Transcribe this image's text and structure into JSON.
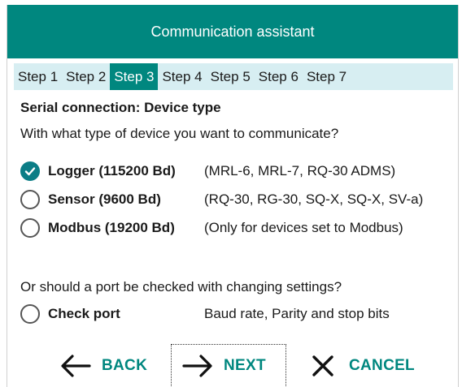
{
  "window": {
    "title": "Communication assistant"
  },
  "steps": [
    "Step 1",
    "Step 2",
    "Step 3",
    "Step 4",
    "Step 5",
    "Step 6",
    "Step 7"
  ],
  "active_step": "Step 3",
  "content": {
    "heading": "Serial connection: Device type",
    "question": "With what type of device you want to communicate?",
    "options": [
      {
        "label": "Logger (115200 Bd)",
        "desc": "(MRL-6, MRL-7, RQ-30 ADMS)",
        "checked": true
      },
      {
        "label": "Sensor (9600 Bd)",
        "desc": "(RQ-30, RG-30, SQ-X, SQ-X, SV-a)",
        "checked": false
      },
      {
        "label": "Modbus (19200 Bd)",
        "desc": "(Only for devices set to Modbus)",
        "checked": false
      }
    ],
    "question2": "Or should a port be checked with changing settings?",
    "check_port": {
      "label": "Check port",
      "desc": "Baud rate, Parity and stop bits",
      "checked": false
    }
  },
  "footer": {
    "back_label": "BACK",
    "next_label": "NEXT",
    "cancel_label": "CANCEL"
  },
  "colors": {
    "accent": "#00877f",
    "step_bar": "#d7eef2",
    "radio_checked": "#0b7d86"
  }
}
